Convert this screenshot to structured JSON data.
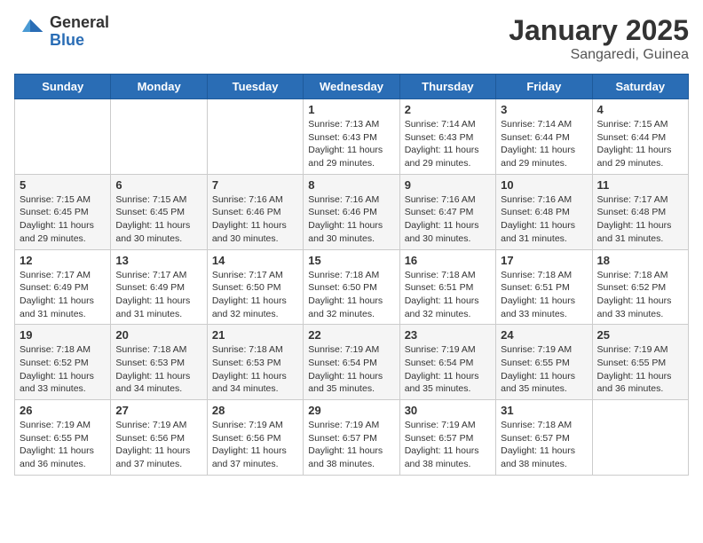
{
  "logo": {
    "general": "General",
    "blue": "Blue"
  },
  "header": {
    "month": "January 2025",
    "location": "Sangaredi, Guinea"
  },
  "days_of_week": [
    "Sunday",
    "Monday",
    "Tuesday",
    "Wednesday",
    "Thursday",
    "Friday",
    "Saturday"
  ],
  "weeks": [
    [
      {
        "day": "",
        "sunrise": "",
        "sunset": "",
        "daylight": ""
      },
      {
        "day": "",
        "sunrise": "",
        "sunset": "",
        "daylight": ""
      },
      {
        "day": "",
        "sunrise": "",
        "sunset": "",
        "daylight": ""
      },
      {
        "day": "1",
        "sunrise": "Sunrise: 7:13 AM",
        "sunset": "Sunset: 6:43 PM",
        "daylight": "Daylight: 11 hours and 29 minutes."
      },
      {
        "day": "2",
        "sunrise": "Sunrise: 7:14 AM",
        "sunset": "Sunset: 6:43 PM",
        "daylight": "Daylight: 11 hours and 29 minutes."
      },
      {
        "day": "3",
        "sunrise": "Sunrise: 7:14 AM",
        "sunset": "Sunset: 6:44 PM",
        "daylight": "Daylight: 11 hours and 29 minutes."
      },
      {
        "day": "4",
        "sunrise": "Sunrise: 7:15 AM",
        "sunset": "Sunset: 6:44 PM",
        "daylight": "Daylight: 11 hours and 29 minutes."
      }
    ],
    [
      {
        "day": "5",
        "sunrise": "Sunrise: 7:15 AM",
        "sunset": "Sunset: 6:45 PM",
        "daylight": "Daylight: 11 hours and 29 minutes."
      },
      {
        "day": "6",
        "sunrise": "Sunrise: 7:15 AM",
        "sunset": "Sunset: 6:45 PM",
        "daylight": "Daylight: 11 hours and 30 minutes."
      },
      {
        "day": "7",
        "sunrise": "Sunrise: 7:16 AM",
        "sunset": "Sunset: 6:46 PM",
        "daylight": "Daylight: 11 hours and 30 minutes."
      },
      {
        "day": "8",
        "sunrise": "Sunrise: 7:16 AM",
        "sunset": "Sunset: 6:46 PM",
        "daylight": "Daylight: 11 hours and 30 minutes."
      },
      {
        "day": "9",
        "sunrise": "Sunrise: 7:16 AM",
        "sunset": "Sunset: 6:47 PM",
        "daylight": "Daylight: 11 hours and 30 minutes."
      },
      {
        "day": "10",
        "sunrise": "Sunrise: 7:16 AM",
        "sunset": "Sunset: 6:48 PM",
        "daylight": "Daylight: 11 hours and 31 minutes."
      },
      {
        "day": "11",
        "sunrise": "Sunrise: 7:17 AM",
        "sunset": "Sunset: 6:48 PM",
        "daylight": "Daylight: 11 hours and 31 minutes."
      }
    ],
    [
      {
        "day": "12",
        "sunrise": "Sunrise: 7:17 AM",
        "sunset": "Sunset: 6:49 PM",
        "daylight": "Daylight: 11 hours and 31 minutes."
      },
      {
        "day": "13",
        "sunrise": "Sunrise: 7:17 AM",
        "sunset": "Sunset: 6:49 PM",
        "daylight": "Daylight: 11 hours and 31 minutes."
      },
      {
        "day": "14",
        "sunrise": "Sunrise: 7:17 AM",
        "sunset": "Sunset: 6:50 PM",
        "daylight": "Daylight: 11 hours and 32 minutes."
      },
      {
        "day": "15",
        "sunrise": "Sunrise: 7:18 AM",
        "sunset": "Sunset: 6:50 PM",
        "daylight": "Daylight: 11 hours and 32 minutes."
      },
      {
        "day": "16",
        "sunrise": "Sunrise: 7:18 AM",
        "sunset": "Sunset: 6:51 PM",
        "daylight": "Daylight: 11 hours and 32 minutes."
      },
      {
        "day": "17",
        "sunrise": "Sunrise: 7:18 AM",
        "sunset": "Sunset: 6:51 PM",
        "daylight": "Daylight: 11 hours and 33 minutes."
      },
      {
        "day": "18",
        "sunrise": "Sunrise: 7:18 AM",
        "sunset": "Sunset: 6:52 PM",
        "daylight": "Daylight: 11 hours and 33 minutes."
      }
    ],
    [
      {
        "day": "19",
        "sunrise": "Sunrise: 7:18 AM",
        "sunset": "Sunset: 6:52 PM",
        "daylight": "Daylight: 11 hours and 33 minutes."
      },
      {
        "day": "20",
        "sunrise": "Sunrise: 7:18 AM",
        "sunset": "Sunset: 6:53 PM",
        "daylight": "Daylight: 11 hours and 34 minutes."
      },
      {
        "day": "21",
        "sunrise": "Sunrise: 7:18 AM",
        "sunset": "Sunset: 6:53 PM",
        "daylight": "Daylight: 11 hours and 34 minutes."
      },
      {
        "day": "22",
        "sunrise": "Sunrise: 7:19 AM",
        "sunset": "Sunset: 6:54 PM",
        "daylight": "Daylight: 11 hours and 35 minutes."
      },
      {
        "day": "23",
        "sunrise": "Sunrise: 7:19 AM",
        "sunset": "Sunset: 6:54 PM",
        "daylight": "Daylight: 11 hours and 35 minutes."
      },
      {
        "day": "24",
        "sunrise": "Sunrise: 7:19 AM",
        "sunset": "Sunset: 6:55 PM",
        "daylight": "Daylight: 11 hours and 35 minutes."
      },
      {
        "day": "25",
        "sunrise": "Sunrise: 7:19 AM",
        "sunset": "Sunset: 6:55 PM",
        "daylight": "Daylight: 11 hours and 36 minutes."
      }
    ],
    [
      {
        "day": "26",
        "sunrise": "Sunrise: 7:19 AM",
        "sunset": "Sunset: 6:55 PM",
        "daylight": "Daylight: 11 hours and 36 minutes."
      },
      {
        "day": "27",
        "sunrise": "Sunrise: 7:19 AM",
        "sunset": "Sunset: 6:56 PM",
        "daylight": "Daylight: 11 hours and 37 minutes."
      },
      {
        "day": "28",
        "sunrise": "Sunrise: 7:19 AM",
        "sunset": "Sunset: 6:56 PM",
        "daylight": "Daylight: 11 hours and 37 minutes."
      },
      {
        "day": "29",
        "sunrise": "Sunrise: 7:19 AM",
        "sunset": "Sunset: 6:57 PM",
        "daylight": "Daylight: 11 hours and 38 minutes."
      },
      {
        "day": "30",
        "sunrise": "Sunrise: 7:19 AM",
        "sunset": "Sunset: 6:57 PM",
        "daylight": "Daylight: 11 hours and 38 minutes."
      },
      {
        "day": "31",
        "sunrise": "Sunrise: 7:18 AM",
        "sunset": "Sunset: 6:57 PM",
        "daylight": "Daylight: 11 hours and 38 minutes."
      },
      {
        "day": "",
        "sunrise": "",
        "sunset": "",
        "daylight": ""
      }
    ]
  ]
}
